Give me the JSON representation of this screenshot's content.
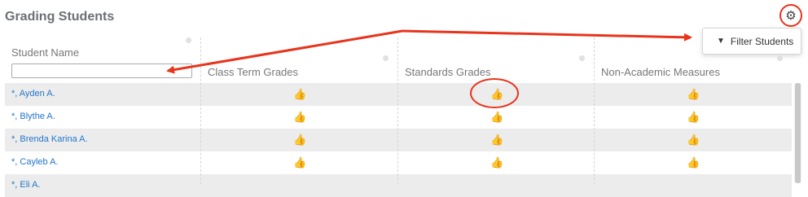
{
  "page": {
    "title": "Grading Students"
  },
  "settings": {
    "icon": "gear-icon"
  },
  "dropdown": {
    "item_label": "Filter Students",
    "item_icon": "filter-icon"
  },
  "columns": [
    {
      "label": "Student Name"
    },
    {
      "label": "Class Term Grades"
    },
    {
      "label": "Standards Grades"
    },
    {
      "label": "Non-Academic Measures"
    }
  ],
  "search": {
    "value": "",
    "placeholder": ""
  },
  "rows": [
    {
      "name": "*, Ayden A."
    },
    {
      "name": "*, Blythe A."
    },
    {
      "name": "*, Brenda Karina A."
    },
    {
      "name": "*, Cayleb A."
    },
    {
      "name": "*, Eli A."
    }
  ],
  "status_icon": "thumbs-up-icon",
  "colors": {
    "annotation": "#e8341c",
    "thumb": "#4caf3c",
    "link": "#2376c9"
  }
}
